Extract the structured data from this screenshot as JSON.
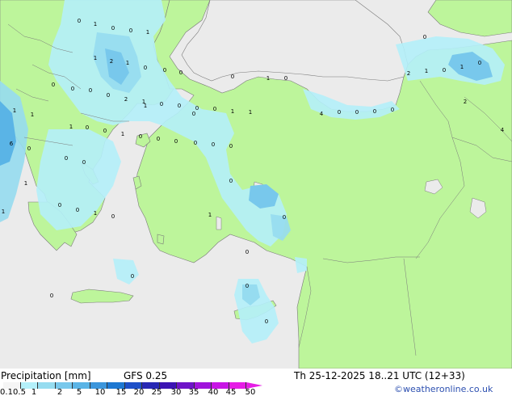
{
  "footer": {
    "title": "Precipitation [mm]",
    "model": "GFS 0.25",
    "valid_time": "Th 25-12-2025 18..21 UTC (12+33)",
    "credit": "©weatheronline.co.uk"
  },
  "legend": {
    "ticks": [
      "0.1",
      "0.5",
      "1",
      "2",
      "5",
      "10",
      "15",
      "20",
      "25",
      "30",
      "35",
      "40",
      "45",
      "50"
    ],
    "colors": [
      "#f5f5f5",
      "#b4f0fa",
      "#96dcf0",
      "#78c8ec",
      "#5ab4e6",
      "#3c96dc",
      "#1e78d2",
      "#1e50c8",
      "#2828b4",
      "#3c14b4",
      "#6e14c8",
      "#a014dc",
      "#c814e6",
      "#e61ee6"
    ]
  },
  "map_colors": {
    "land": "#bdf59b",
    "sea": "#ebebeb",
    "precip_light": "#b4f0fa",
    "precip_mid": "#96dcf0",
    "precip_strong": "#78c8ec",
    "precip_heavy": "#5ab4e6"
  },
  "map_values": [
    "0",
    "1",
    "0",
    "0",
    "1",
    "1",
    "2",
    "1",
    "0",
    "0",
    "0",
    "0",
    "0",
    "0",
    "0",
    "2",
    "1",
    "0",
    "0",
    "0",
    "0",
    "0",
    "1",
    "0",
    "1",
    "1",
    "1",
    "0",
    "0",
    "1",
    "0",
    "0",
    "0",
    "6",
    "0",
    "0",
    "0",
    "1",
    "1",
    "0",
    "0",
    "1",
    "0",
    "0",
    "0",
    "0",
    "0",
    "1",
    "0",
    "0",
    "0",
    "1",
    "0",
    "1",
    "0",
    "0",
    "2",
    "2",
    "4",
    "4",
    "0",
    "0",
    "0",
    "0",
    "0",
    "0",
    "0",
    "1",
    "0",
    "1",
    "1",
    "2"
  ]
}
